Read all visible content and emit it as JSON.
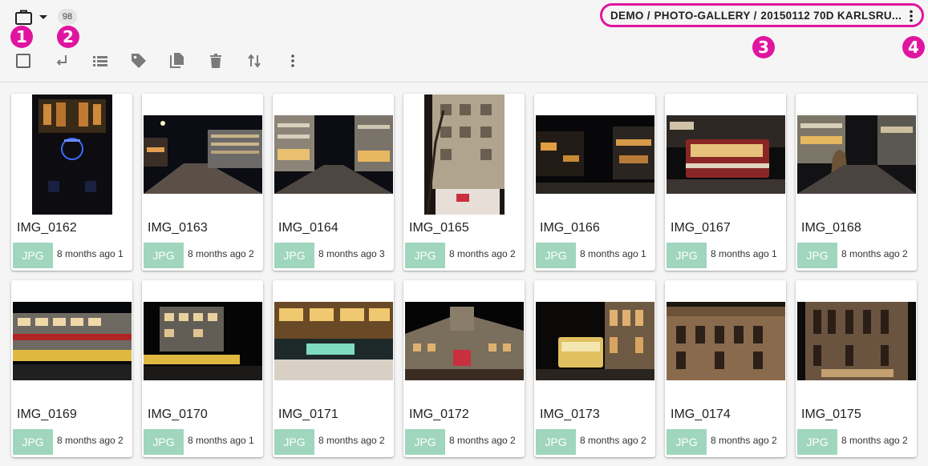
{
  "header": {
    "photo_count": "98",
    "markers": [
      "1",
      "2",
      "3",
      "4"
    ],
    "breadcrumb": [
      "DEMO",
      "PHOTO-GALLERY",
      "20150112 70D KARLSRU..."
    ],
    "breadcrumb_separator": "/"
  },
  "toolbar": {
    "tools": [
      "select-all-checkbox",
      "return-icon",
      "list-view-icon",
      "tag-icon",
      "copy-icon",
      "delete-icon",
      "sort-icon",
      "more-vert-icon"
    ]
  },
  "colors": {
    "accent": "#e0159f",
    "badge": "#9fd6bd",
    "icon": "#7a7a7a"
  },
  "photos": [
    {
      "name": "IMG_0162",
      "type": "JPG",
      "meta": "8 months ago 1"
    },
    {
      "name": "IMG_0163",
      "type": "JPG",
      "meta": "8 months ago 2"
    },
    {
      "name": "IMG_0164",
      "type": "JPG",
      "meta": "8 months ago 3"
    },
    {
      "name": "IMG_0165",
      "type": "JPG",
      "meta": "8 months ago 2"
    },
    {
      "name": "IMG_0166",
      "type": "JPG",
      "meta": "8 months ago 1"
    },
    {
      "name": "IMG_0167",
      "type": "JPG",
      "meta": "8 months ago 1"
    },
    {
      "name": "IMG_0168",
      "type": "JPG",
      "meta": "8 months ago 2"
    },
    {
      "name": "IMG_0169",
      "type": "JPG",
      "meta": "8 months ago 2"
    },
    {
      "name": "IMG_0170",
      "type": "JPG",
      "meta": "8 months ago 1"
    },
    {
      "name": "IMG_0171",
      "type": "JPG",
      "meta": "8 months ago 2"
    },
    {
      "name": "IMG_0172",
      "type": "JPG",
      "meta": "8 months ago 2"
    },
    {
      "name": "IMG_0173",
      "type": "JPG",
      "meta": "8 months ago 2"
    },
    {
      "name": "IMG_0174",
      "type": "JPG",
      "meta": "8 months ago 2"
    },
    {
      "name": "IMG_0175",
      "type": "JPG",
      "meta": "8 months ago 2"
    }
  ]
}
